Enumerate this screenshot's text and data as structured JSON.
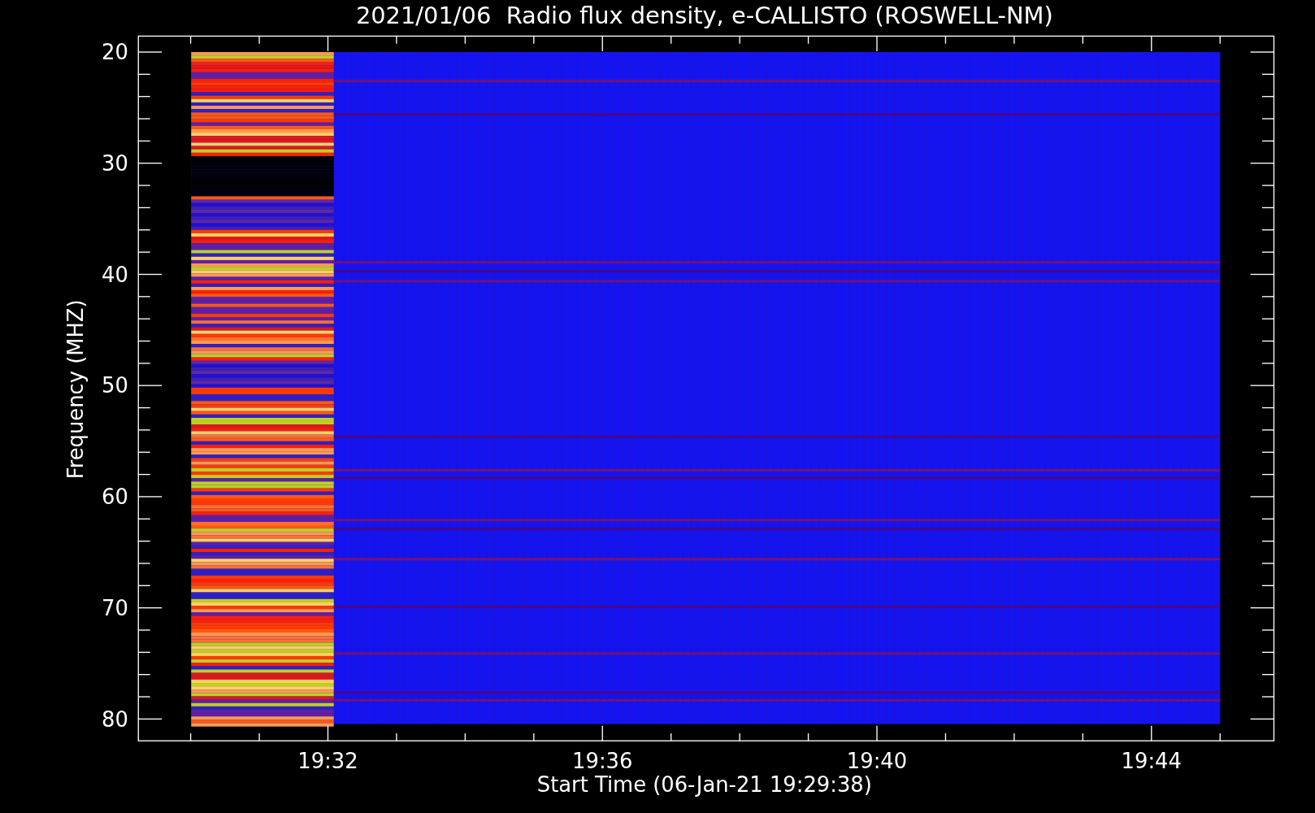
{
  "title": "2021/01/06  Radio flux density, e-CALLISTO (ROSWELL-NM)",
  "y_axis": {
    "label": "Frequency (MHZ)",
    "ticks": [
      "20",
      "30",
      "40",
      "50",
      "60",
      "70",
      "80"
    ]
  },
  "x_axis": {
    "label": "Start Time (06-Jan-21 19:29:38)",
    "ticks": [
      "19:32",
      "19:36",
      "19:40",
      "19:44"
    ]
  }
}
